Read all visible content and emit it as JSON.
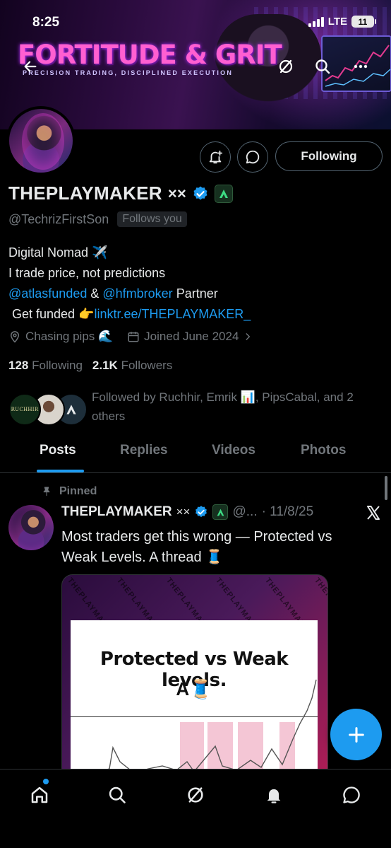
{
  "status_bar": {
    "time": "8:25",
    "network": "LTE",
    "battery": "11"
  },
  "banner": {
    "brand": "FORTITUDE & GRIT",
    "tagline": "PRECISION TRADING, DISCIPLINED EXECUTION"
  },
  "header_icons": [
    "back-arrow-icon",
    "grok-icon",
    "search-icon",
    "more-icon"
  ],
  "profile": {
    "display_name": "THEPLAYMAKER",
    "name_suffix": "××",
    "handle": "@TechrizFirstSon",
    "follows_you": "Follows you",
    "following_button": "Following",
    "bio": {
      "line1": "Digital Nomad ✈️",
      "line2": "I trade price, not predictions",
      "mention1": "@atlasfunded",
      "amp": " & ",
      "mention2": "@hfmbroker",
      "partner": " Partner",
      "funded_prefix": " Get funded 👉",
      "link": "linktr.ee/THEPLAYMAKER_"
    },
    "location": "Chasing pips 🌊",
    "joined": "Joined June 2024",
    "following_count": "128",
    "following_label": "Following",
    "followers_count": "2.1K",
    "followers_label": "Followers",
    "followed_by": "Followed by Ruchhir, Emrik 📊, PipsCabal, and 2 others",
    "follower_avatar_label": "RUCHHIR"
  },
  "tabs": [
    {
      "label": "Posts",
      "active": true
    },
    {
      "label": "Replies",
      "active": false
    },
    {
      "label": "Videos",
      "active": false
    },
    {
      "label": "Photos",
      "active": false
    }
  ],
  "post": {
    "pinned_label": "Pinned",
    "author": "THEPLAYMAKER",
    "author_suffix": "××",
    "handle": "@...",
    "date": "· 11/8/25",
    "text": "Most traders get this wrong — Protected vs Weak Levels. A thread 🧵",
    "media": {
      "watermark": "THEPLAYMAKER",
      "title": "Protected vs Weak levels.",
      "subtitle": "A🧵"
    }
  },
  "colors": {
    "accent": "#1d9bf0",
    "muted": "#71767b",
    "text": "#e7e9ea",
    "background": "#000000"
  },
  "bottom_nav": [
    "home-icon",
    "search-icon",
    "grok-icon",
    "notifications-icon",
    "messages-icon"
  ]
}
